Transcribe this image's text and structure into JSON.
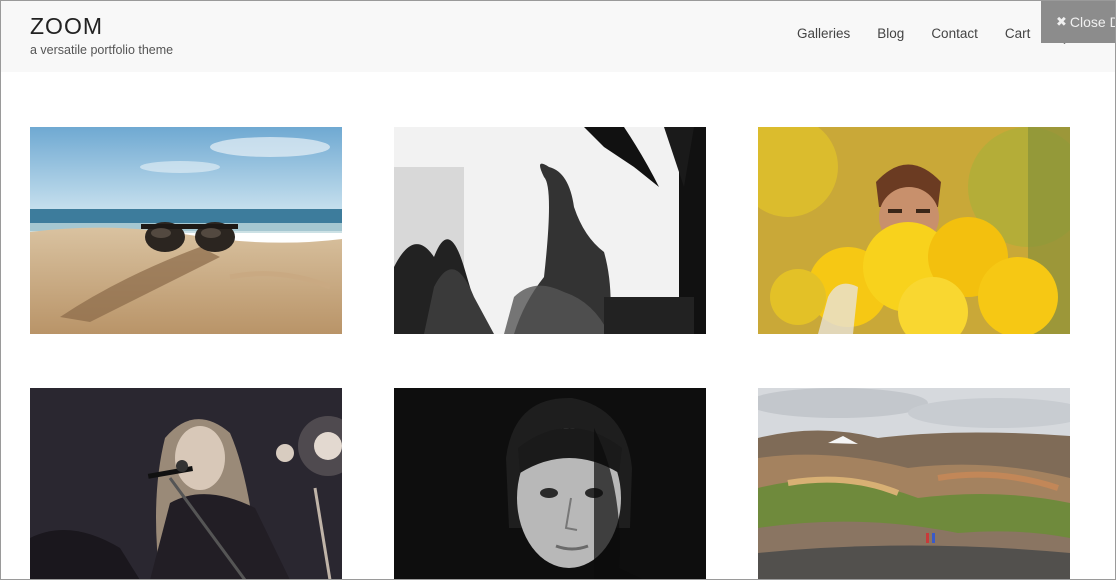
{
  "header": {
    "title": "ZOOM",
    "tagline": "a versatile portfolio theme"
  },
  "nav": {
    "items": [
      {
        "label": "Galleries"
      },
      {
        "label": "Blog"
      },
      {
        "label": "Contact"
      },
      {
        "label": "Cart"
      }
    ],
    "search_icon": "search-icon"
  },
  "close_demo": {
    "icon": "close-icon",
    "label": "Close D"
  },
  "gallery": {
    "items": [
      {
        "subject": "sunglasses-on-beach-sand",
        "icon": "photo"
      },
      {
        "subject": "silhouette-double-exposure-palm",
        "icon": "photo"
      },
      {
        "subject": "man-yellow-smoke",
        "icon": "photo"
      },
      {
        "subject": "singer-with-microphone",
        "icon": "photo"
      },
      {
        "subject": "portrait-woman-dark",
        "icon": "photo"
      },
      {
        "subject": "colorful-mountains-landscape",
        "icon": "photo"
      }
    ]
  },
  "colors": {
    "header_bg": "#f8f8f8",
    "close_demo_bg": "#8c8c8c",
    "text_dark": "#222222",
    "nav_text": "#444444"
  }
}
